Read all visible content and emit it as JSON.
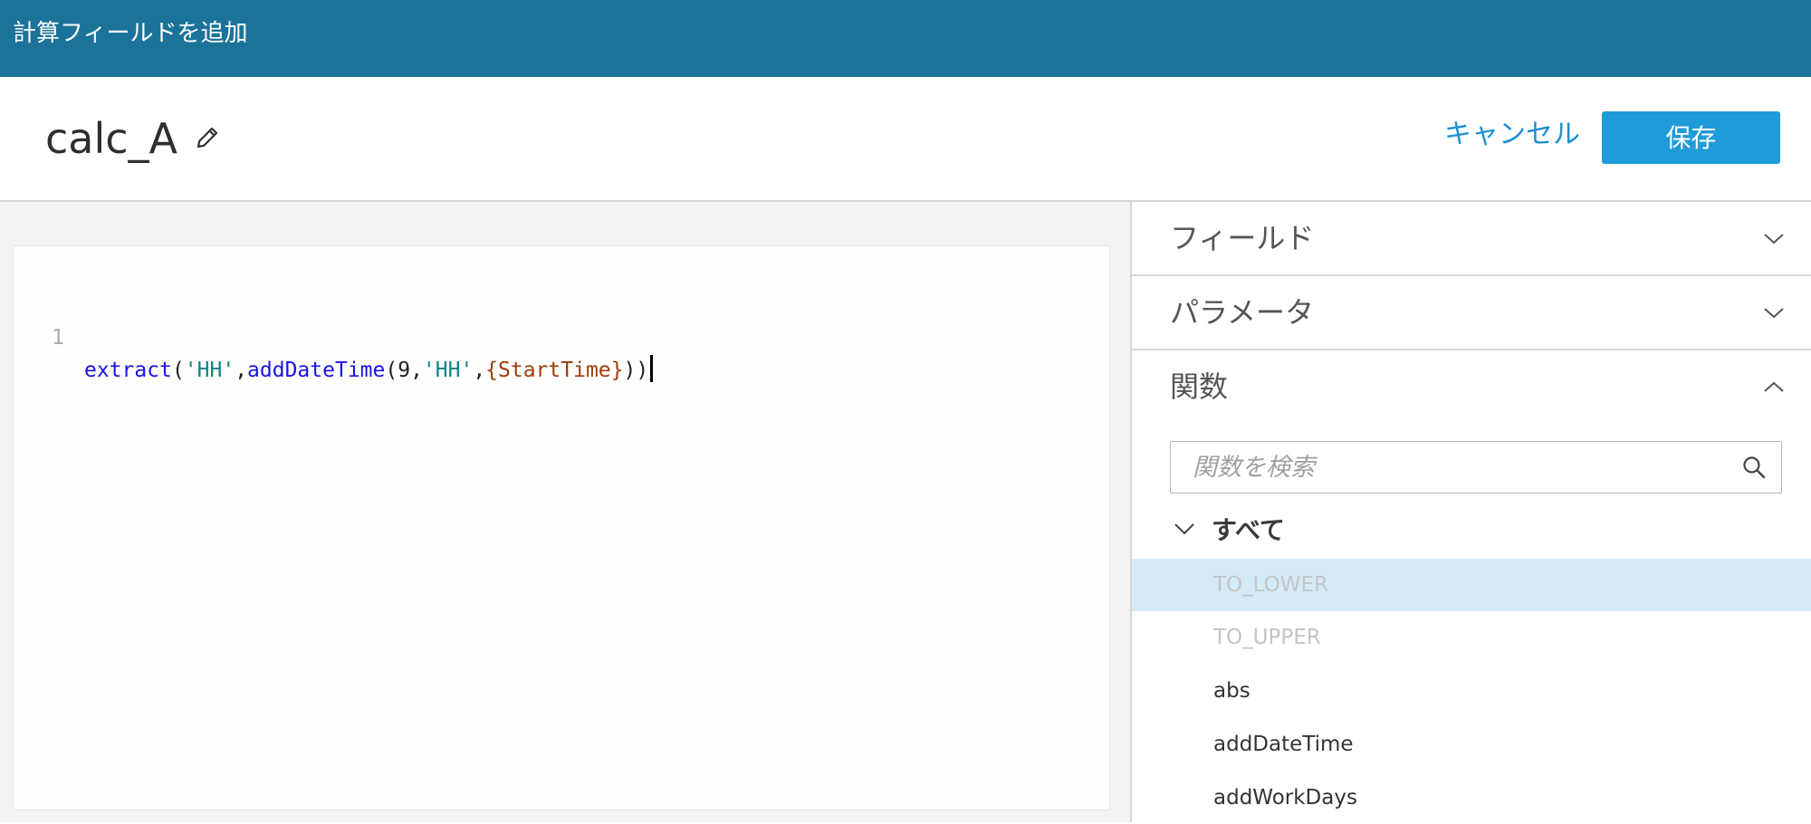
{
  "topbar": {
    "title": "計算フィールドを追加"
  },
  "header": {
    "calc_name": "calc_A",
    "cancel_label": "キャンセル",
    "save_label": "保存"
  },
  "editor": {
    "line_number": "1",
    "tokens": {
      "t1": "extract",
      "t2": "(",
      "t3": "'HH'",
      "t4": ",",
      "t5": "addDateTime",
      "t6": "(9,",
      "t7": "'HH'",
      "t8": ",",
      "t9": "{StartTime}",
      "t10": "))"
    }
  },
  "sidebar": {
    "sections": [
      {
        "label": "フィールド",
        "state": "collapsed"
      },
      {
        "label": "パラメータ",
        "state": "collapsed"
      },
      {
        "label": "関数",
        "state": "expanded"
      }
    ],
    "search": {
      "placeholder": "関数を検索",
      "value": ""
    },
    "tree": {
      "group_label": "すべて",
      "items": [
        {
          "label": "TO_LOWER",
          "state": "selected-disabled"
        },
        {
          "label": "TO_UPPER",
          "state": "disabled"
        },
        {
          "label": "abs",
          "state": "normal"
        },
        {
          "label": "addDateTime",
          "state": "normal"
        },
        {
          "label": "addWorkDays",
          "state": "normal"
        }
      ]
    }
  },
  "colors": {
    "topbar": "#1b7399",
    "accent": "#1f9bd8",
    "link": "#1b8fd1",
    "selected_row": "#d4eaf6",
    "token_function": "#1a13e8",
    "token_string": "#0e8388",
    "token_field": "#9c3d0b"
  },
  "icons": {
    "edit": "pencil-icon",
    "collapsed": "chevron-down-icon",
    "expanded": "chevron-up-icon",
    "search": "search-icon"
  }
}
